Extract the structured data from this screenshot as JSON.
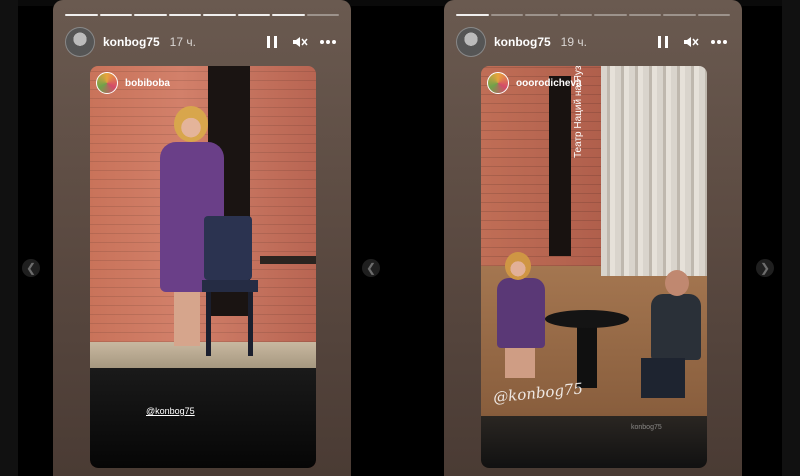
{
  "colors": {
    "story_bg_top": "#6a5a50",
    "story_bg_bottom": "#4a3b34",
    "accent_text": "#ffffff"
  },
  "stories": [
    {
      "username": "konbog75",
      "time": "17 ч.",
      "segments_total": 8,
      "segments_done": 7,
      "repost_user": "bobiboba",
      "mention_tag": "@konbog75",
      "audio_state": "muted"
    },
    {
      "username": "konbog75",
      "time": "19 ч.",
      "segments_total": 8,
      "segments_done": 1,
      "repost_user": "ooorodicheva",
      "venue_text": "Театр Наций на Яузе",
      "mention_tag": "@konbog75",
      "watermark": "konbog75",
      "audio_state": "muted"
    }
  ],
  "icons": {
    "pause": "pause-icon",
    "mute": "mute-icon",
    "more": "more-icon",
    "prev": "chevron-left-icon",
    "next": "chevron-right-icon"
  }
}
